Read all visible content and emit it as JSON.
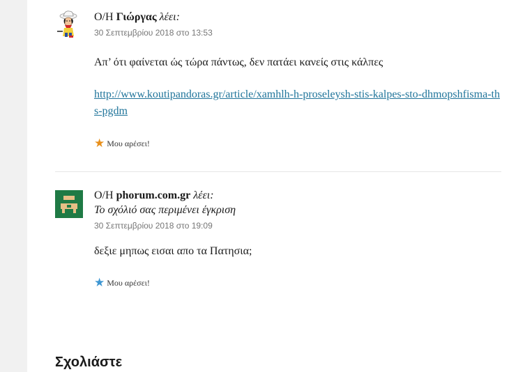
{
  "comments": [
    {
      "author_prefix": "Ο/Η",
      "author_name": "Γιώργας",
      "says": "λέει:",
      "date": "30 Σεπτεμβρίου 2018 στο 13:53",
      "text": "Απ’ ότι φαίνεται ώς τώρα πάντως, δεν πατάει κανείς στις κάλπες",
      "link": "http://www.koutipandoras.gr/article/xamhlh-h-proseleysh-stis-kalpes-sto-dhmopshfisma-ths-pgdm",
      "like_label": "Μου αρέσει!",
      "avatar_icon": "cowboy-cartoon-avatar",
      "like_star_color": "#e8901c"
    },
    {
      "author_prefix": "Ο/Η",
      "author_name": "phorum.com.gr",
      "says": "λέει:",
      "moderation": "Το σχόλιό σας περιμένει έγκριση",
      "date": "30 Σεπτεμβρίου 2018 στο 19:09",
      "text": "δεξιε μηπως εισαι απο τα Πατησια;",
      "like_label": "Μου αρέσει!",
      "avatar_icon": "pixel-identicon-avatar",
      "like_star_color": "#3d96d2"
    }
  ],
  "reply_section": {
    "title": "Σχολιάστε"
  }
}
